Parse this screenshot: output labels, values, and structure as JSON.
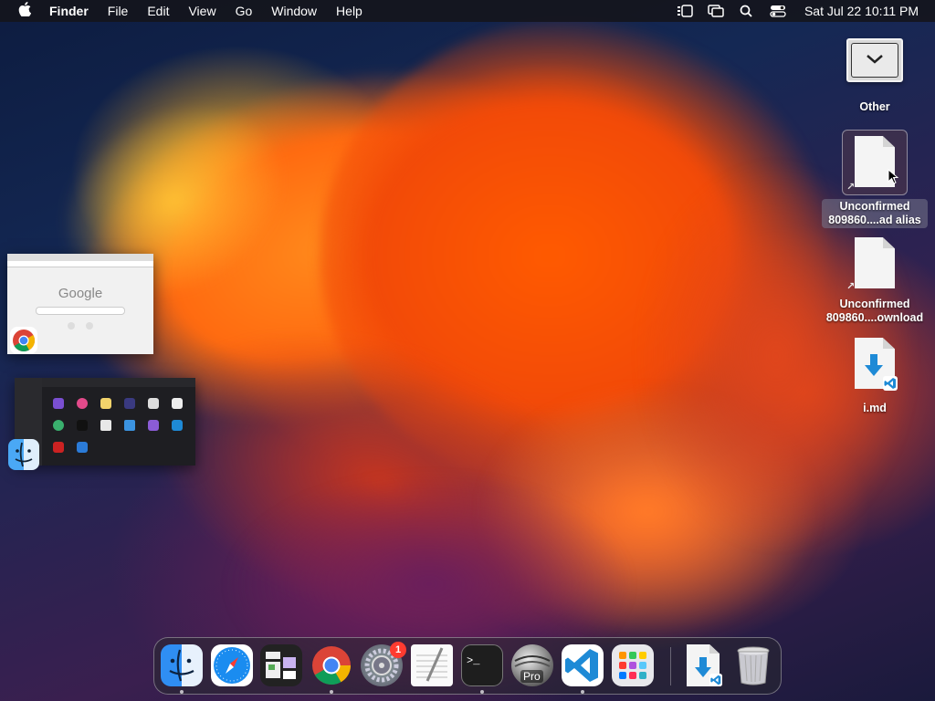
{
  "menubar": {
    "app_name": "Finder",
    "items": [
      "File",
      "Edit",
      "View",
      "Go",
      "Window",
      "Help"
    ],
    "clock": "Sat Jul 22  10:11 PM"
  },
  "desktop": {
    "items": [
      {
        "label": "Other"
      },
      {
        "label": "Unconfirmed 809860....ad alias"
      },
      {
        "label": "Unconfirmed 809860....ownload"
      },
      {
        "label": "i.md"
      }
    ]
  },
  "previews": {
    "chrome_title": "Google"
  },
  "dock": {
    "apps": [
      "Finder",
      "Safari",
      "Mosaic",
      "Google Chrome",
      "System Settings",
      "TextEdit",
      "Terminal",
      "Final Cut Pro",
      "Visual Studio Code",
      "Launchpad",
      "Downloads",
      "Trash"
    ],
    "settings_badge": "1",
    "fcp_badge_text": "Pro"
  },
  "colors": {
    "accent": "#0a84ff",
    "badge": "#ff3b30",
    "vscode": "#1e8ad6"
  }
}
